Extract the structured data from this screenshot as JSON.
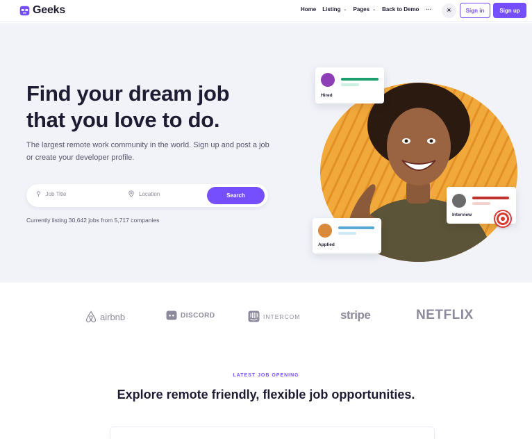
{
  "brand": {
    "name": "Geeks",
    "accent": "#754ffe"
  },
  "nav": {
    "links": [
      {
        "label": "Home",
        "has_dropdown": false
      },
      {
        "label": "Listing",
        "has_dropdown": true
      },
      {
        "label": "Pages",
        "has_dropdown": true
      },
      {
        "label": "Back to Demo",
        "has_dropdown": false
      }
    ],
    "more_label": "···",
    "theme_icon": "☀",
    "signin_label": "Sign in",
    "signup_label": "Sign up"
  },
  "hero": {
    "title": "Find your dream job that you love to do.",
    "subtitle": "The largest remote work community in the world. Sign up and post a job or create your developer profile.",
    "search": {
      "job_placeholder": "Job Title",
      "location_placeholder": "Location",
      "button_label": "Search"
    },
    "listing_text": "Currently listing 30,642 jobs from 5,717 companies",
    "cards": {
      "hired": "Hired",
      "interview": "Interview",
      "applied": "Applied"
    }
  },
  "logos": {
    "airbnb": "airbnb",
    "discord": "DISCORD",
    "intercom": "INTERCOM",
    "stripe": "stripe",
    "netflix": "NETFLIX"
  },
  "latest": {
    "eyebrow": "LATEST JOB OPENING",
    "title": "Explore remote friendly, flexible job opportunities."
  }
}
